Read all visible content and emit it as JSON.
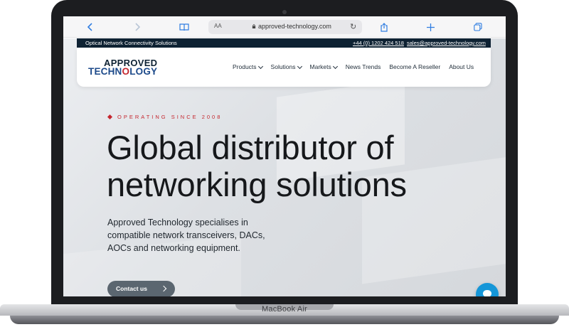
{
  "device": {
    "model_label": "MacBook Air"
  },
  "browser": {
    "text_size_label": "AA",
    "url": "approved-technology.com",
    "icons": [
      "back-icon",
      "forward-icon",
      "bookmarks-icon",
      "lock-icon",
      "reload-icon",
      "share-icon",
      "new-tab-icon",
      "tabs-icon"
    ],
    "accent_color": "#2f7de1"
  },
  "topbar": {
    "tagline": "Optical Network Connectivity Solutions",
    "phone": "+44 (0) 1202 424 518",
    "email": "sales@approved-technology.com",
    "background": "#0e2233"
  },
  "logo": {
    "line1": "APPROVED",
    "line2_start": "TECHN",
    "line2_mark": "O",
    "line2_end": "LOGY"
  },
  "nav": [
    {
      "label": "Products",
      "has_dropdown": true
    },
    {
      "label": "Solutions",
      "has_dropdown": true
    },
    {
      "label": "Markets",
      "has_dropdown": true
    },
    {
      "label": "News Trends",
      "has_dropdown": false
    },
    {
      "label": "Become A Reseller",
      "has_dropdown": false
    },
    {
      "label": "About Us",
      "has_dropdown": false
    }
  ],
  "hero": {
    "eyebrow": "OPERATING SINCE 2008",
    "headline_line1": "Global distributor of",
    "headline_line2": "networking solutions",
    "intro_line1": "Approved Technology specialises in",
    "intro_line2": "compatible network transceivers, DACs,",
    "intro_line3": "AOCs and networking equipment.",
    "cta_label": "Contact us",
    "accent_color": "#c5272f"
  },
  "chat": {
    "icon": "chat-icon",
    "color": "#1596d8"
  }
}
